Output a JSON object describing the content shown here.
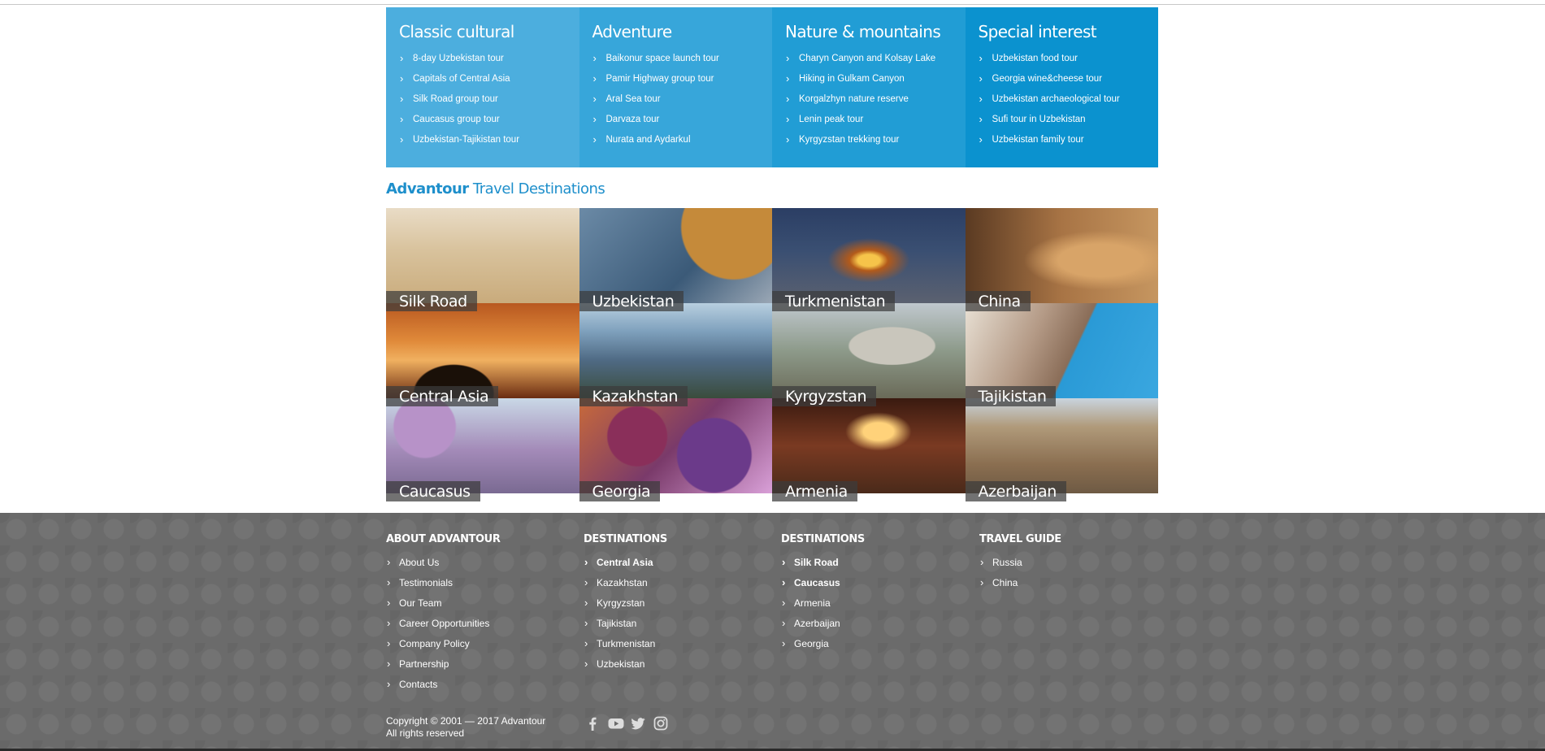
{
  "tour_columns": [
    {
      "title": "Classic cultural",
      "items": [
        "8-day Uzbekistan tour",
        "Capitals of Central Asia",
        "Silk Road group tour",
        "Caucasus group tour",
        "Uzbekistan-Tajikistan tour"
      ]
    },
    {
      "title": "Adventure",
      "items": [
        "Baikonur space launch tour",
        "Pamir Highway group tour",
        "Aral Sea tour",
        "Darvaza tour",
        "Nurata and Aydarkul"
      ]
    },
    {
      "title": "Nature & mountains",
      "items": [
        "Charyn Canyon and Kolsay Lake",
        "Hiking in Gulkam Canyon",
        "Korgalzhyn nature reserve",
        "Lenin peak tour",
        "Kyrgyzstan trekking tour"
      ]
    },
    {
      "title": "Special interest",
      "items": [
        "Uzbekistan food tour",
        "Georgia wine&cheese tour",
        "Uzbekistan archaeological tour",
        "Sufi tour in Uzbekistan",
        "Uzbekistan family tour"
      ]
    }
  ],
  "destinations_heading": {
    "brand": "Advantour",
    "rest": " Travel Destinations"
  },
  "destinations": [
    "Silk Road",
    "Uzbekistan",
    "Turkmenistan",
    "China",
    "Central Asia",
    "Kazakhstan",
    "Kyrgyzstan",
    "Tajikistan",
    "Caucasus",
    "Georgia",
    "Armenia",
    "Azerbaijan"
  ],
  "footer": {
    "columns": [
      {
        "title": "ABOUT ADVANTOUR",
        "items": [
          "About Us",
          "Testimonials",
          "Our Team",
          "Career Opportunities",
          "Company Policy",
          "Partnership",
          "Contacts"
        ],
        "bold": []
      },
      {
        "title": "DESTINATIONS",
        "items": [
          "Central Asia",
          "Kazakhstan",
          "Kyrgyzstan",
          "Tajikistan",
          "Turkmenistan",
          "Uzbekistan"
        ],
        "bold": [
          0
        ]
      },
      {
        "title": "DESTINATIONS",
        "items": [
          "Silk Road",
          "Caucasus",
          "Armenia",
          "Azerbaijan",
          "Georgia"
        ],
        "bold": [
          0,
          1
        ]
      },
      {
        "title": "TRAVEL GUIDE",
        "items": [
          "Russia",
          "China"
        ],
        "bold": []
      }
    ],
    "copyright_line1": "Copyright © 2001 — 2017 Advantour",
    "copyright_line2": "All rights reserved",
    "social_icons": [
      "facebook-icon",
      "youtube-icon",
      "twitter-icon",
      "instagram-icon"
    ]
  },
  "colors": {
    "tile_column_1": "#4caede",
    "tile_column_2": "#37a6da",
    "tile_column_3": "#219dd5",
    "tile_column_4": "#0b92cf",
    "heading_blue": "#1e8fcb",
    "footer_bg": "#6b6b6b"
  }
}
